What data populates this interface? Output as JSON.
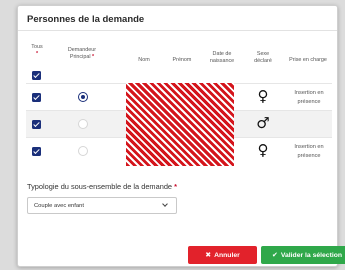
{
  "modal": {
    "title": "Personnes de la demande"
  },
  "table": {
    "headers": {
      "tous": "Tous",
      "demandeur_line1": "Demandeur",
      "demandeur_line2": "Principal",
      "nom": "Nom",
      "prenom": "Prénom",
      "date_line1": "Date de",
      "date_line2": "naissance",
      "sexe_line1": "Sexe",
      "sexe_line2": "déclaré",
      "prise": "Prise en charge"
    },
    "required_mark": "*",
    "rows": [
      {
        "checked": true,
        "principal": true,
        "sexe_icon": "female-icon",
        "sexe_glyph": "♀",
        "prise_line1": "Insertion en",
        "prise_line2": "présence"
      },
      {
        "checked": true,
        "principal": false,
        "sexe_icon": "male-icon",
        "sexe_glyph": "♂",
        "prise_line1": "",
        "prise_line2": ""
      },
      {
        "checked": true,
        "principal": false,
        "sexe_icon": "female-icon",
        "sexe_glyph": "♀",
        "prise_line1": "Insertion en",
        "prise_line2": "présence"
      }
    ]
  },
  "typologie": {
    "label": "Typologie du sous-ensemble de la demande",
    "required_mark": "*",
    "selected": "Couple avec enfant"
  },
  "buttons": {
    "cancel_icon": "✖",
    "cancel_label": "Annuler",
    "ok_icon": "✔",
    "ok_label": "Valider la sélection"
  },
  "colors": {
    "checkbox": "#1a2f7a",
    "cancel": "#e2222b",
    "confirm": "#2fa84a",
    "required": "#c8102e",
    "redaction": "#d4151c"
  }
}
